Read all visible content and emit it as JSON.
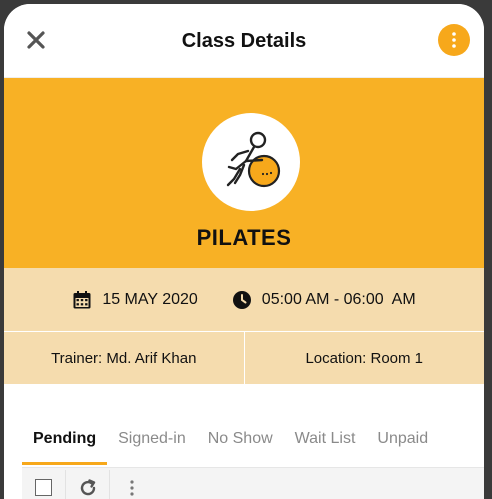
{
  "header": {
    "title": "Class Details",
    "close_icon": "close-icon",
    "menu_icon": "more-vertical-icon",
    "accent_color": "#f7a81b"
  },
  "hero": {
    "class_name": "PILATES",
    "icon": "pilates-ball-icon",
    "background_color": "#f8b125"
  },
  "schedule": {
    "date": "15 MAY 2020",
    "date_icon": "calendar-icon",
    "time": "05:00 AM - 06:00  AM",
    "time_icon": "clock-icon"
  },
  "meta": {
    "trainer": "Trainer: Md. Arif Khan",
    "location": "Location: Room 1"
  },
  "tabs": [
    {
      "label": "Pending",
      "active": true
    },
    {
      "label": "Signed-in",
      "active": false
    },
    {
      "label": "No Show",
      "active": false
    },
    {
      "label": "Wait List",
      "active": false
    },
    {
      "label": "Unpaid",
      "active": false
    }
  ],
  "toolbar": {
    "select_icon": "checkbox-icon",
    "refresh_icon": "refresh-icon",
    "more_icon": "more-vertical-icon"
  }
}
